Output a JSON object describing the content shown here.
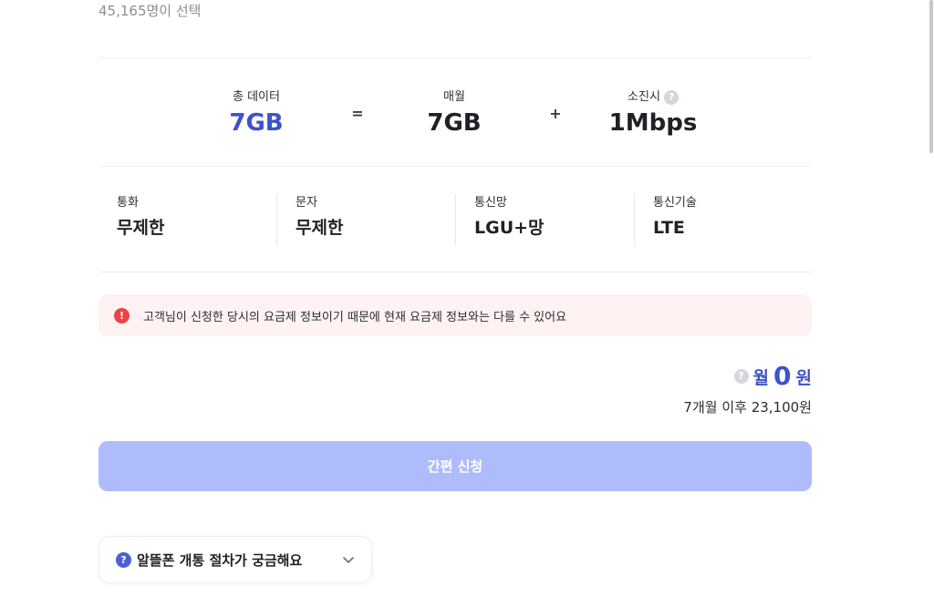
{
  "header": {
    "selected_count": "45,165명이 선택"
  },
  "data_summary": {
    "total": {
      "label": "총 데이터",
      "value": "7GB"
    },
    "equals": "=",
    "monthly": {
      "label": "매월",
      "value": "7GB"
    },
    "plus": "+",
    "exhausted": {
      "label": "소진시",
      "value": "1Mbps"
    }
  },
  "specs": [
    {
      "label": "통화",
      "value": "무제한"
    },
    {
      "label": "문자",
      "value": "무제한"
    },
    {
      "label": "통신망",
      "value": "LGU+망"
    },
    {
      "label": "통신기술",
      "value": "LTE"
    }
  ],
  "notice": {
    "icon": "!",
    "text": "고객님이 신청한 당시의 요금제 정보이기 때문에 현재 요금제 정보와는 다를 수 있어요"
  },
  "price": {
    "unit_prefix": "월",
    "amount": "0",
    "unit_suffix": "원",
    "after": "7개월 이후 23,100원"
  },
  "apply_button": {
    "label": "간편 신청"
  },
  "faq": {
    "icon": "?",
    "label": "알뜰폰 개통 절차가 궁금해요"
  },
  "help_glyph": "?",
  "colors": {
    "accent": "#3e52c9",
    "button_disabled": "#aebcfc",
    "notice_bg": "#fff2f2",
    "notice_icon": "#ef4444"
  }
}
